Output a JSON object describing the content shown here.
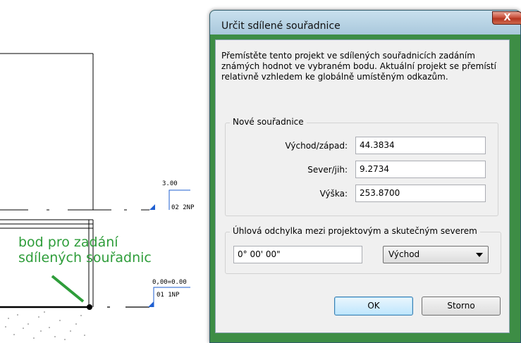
{
  "background": {
    "annotation_line1": "bod pro zadání",
    "annotation_line2": "sdílených souřadnic",
    "level_upper_value": "3.00",
    "level_upper_name": "02 2NP",
    "level_lower_value": "0,00=0.00",
    "level_lower_name": "01 1NP",
    "annotation_color": "#2e9d3a"
  },
  "dialog": {
    "title": "Určit sdílené souřadnice",
    "close_label": "X",
    "description": "Přemístěte tento projekt ve sdílených souřadnicích zadáním známých hodnot ve vybraném bodu. Aktuální projekt se přemístí relativně vzhledem ke globálně umístěným odkazům.",
    "coords_group_label": "Nové souřadnice",
    "east_west_label": "Východ/západ:",
    "east_west_value": "44.3834",
    "north_south_label": "Sever/jih:",
    "north_south_value": "9.2734",
    "elevation_label": "Výška:",
    "elevation_value": "253.8700",
    "angle_group_label": "Úhlová odchylka mezi projektovým a skutečným severem",
    "angle_value": "0° 00' 00\"",
    "direction_selected": "Východ",
    "ok_label": "OK",
    "cancel_label": "Storno"
  }
}
